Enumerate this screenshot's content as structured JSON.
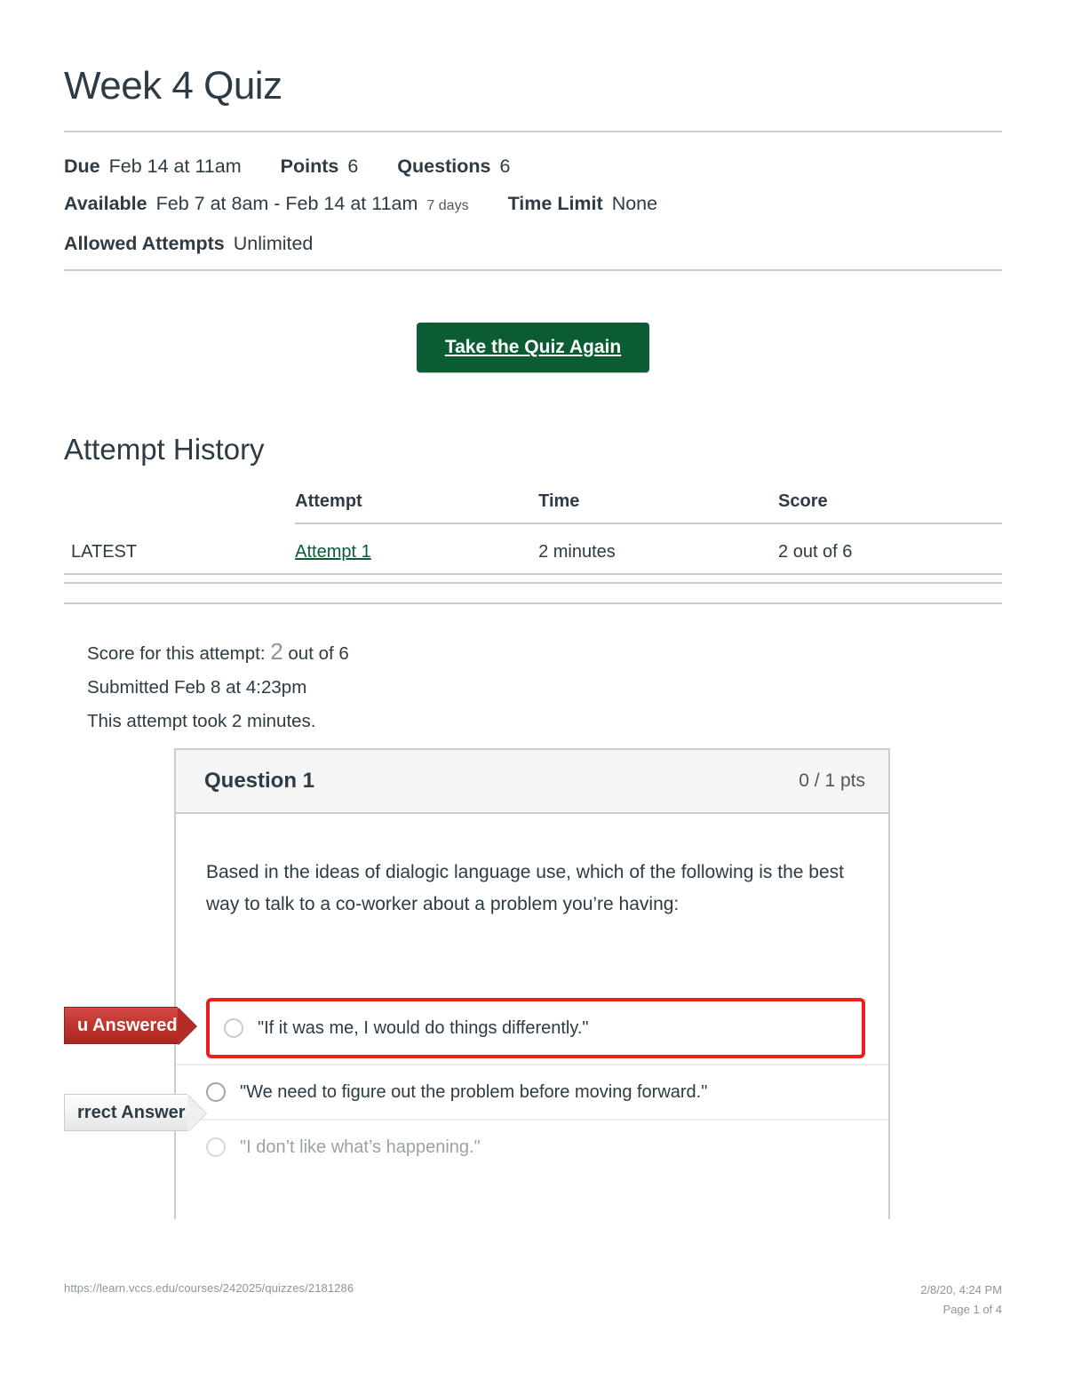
{
  "quiz": {
    "title": "Week 4 Quiz",
    "meta": {
      "due_label": "Due",
      "due_value": "Feb 14 at 11am",
      "points_label": "Points",
      "points_value": "6",
      "questions_label": "Questions",
      "questions_value": "6",
      "available_label": "Available",
      "available_value": "Feb 7 at 8am - Feb 14 at 11am",
      "available_duration": "7 days",
      "time_limit_label": "Time Limit",
      "time_limit_value": "None",
      "allowed_attempts_label": "Allowed Attempts",
      "allowed_attempts_value": "Unlimited"
    },
    "take_again_button": "Take the Quiz Again"
  },
  "attempt_history": {
    "heading": "Attempt History",
    "columns": [
      "",
      "Attempt",
      "Time",
      "Score"
    ],
    "rows": [
      {
        "kept": "LATEST",
        "attempt": "Attempt 1",
        "time": "2 minutes",
        "score": "2 out of 6"
      }
    ]
  },
  "summary": {
    "score_prefix": "Score for this attempt:",
    "score_value": "2",
    "score_suffix": "out of 6",
    "submitted": "Submitted Feb 8 at 4:23pm",
    "duration": "This attempt took 2 minutes."
  },
  "question": {
    "name": "Question 1",
    "points": "0 / 1 pts",
    "text": "Based in the ideas of dialogic language use, which of the following is the best way to talk to a co-worker about a problem you’re having:",
    "ribbon_answered": "u Answered",
    "ribbon_correct": "rrect Answer",
    "answers": [
      {
        "text": "\"If it was me, I would do things differently.\""
      },
      {
        "text": "\"We need to figure out the problem before moving forward.\""
      },
      {
        "text": "\"I don’t like what’s happening.\""
      }
    ]
  },
  "footer": {
    "url": "https://learn.vccs.edu/courses/242025/quizzes/2181286",
    "timestamp": "2/8/20, 4:24 PM",
    "page": "Page 1 of 4"
  },
  "colors": {
    "brand_green": "#0b5c33",
    "wrong_red": "#f01d1d",
    "ribbon_red": "#c0352f",
    "rule_grey": "#c7cdd1",
    "text": "#2d3b45"
  }
}
